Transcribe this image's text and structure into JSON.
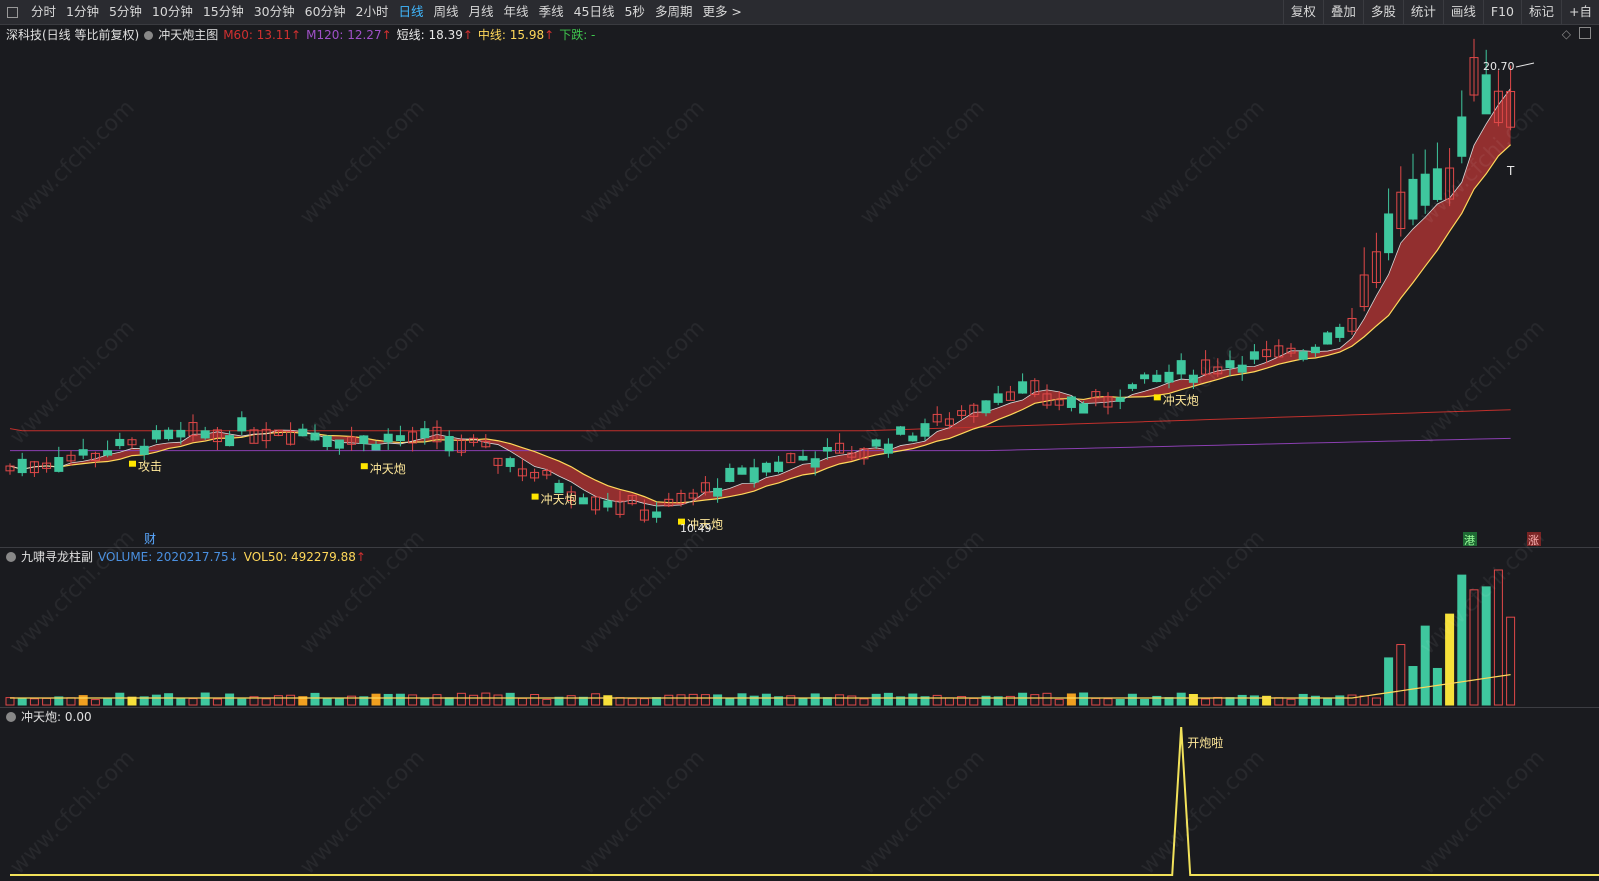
{
  "toolbar": {
    "tabs": [
      "分时",
      "1分钟",
      "5分钟",
      "10分钟",
      "15分钟",
      "30分钟",
      "60分钟",
      "2小时",
      "日线",
      "周线",
      "月线",
      "年线",
      "季线",
      "45日线",
      "5秒",
      "多周期",
      "更多 >"
    ],
    "active_tab": "日线",
    "right_buttons": [
      "复权",
      "叠加",
      "多股",
      "统计",
      "画线",
      "F10",
      "标记",
      "+自"
    ]
  },
  "main_legend": {
    "stock": "深科技(日线 等比前复权)",
    "indicator": "冲天炮主图",
    "m60": "M60: 13.11",
    "m120": "M120: 12.27",
    "short_line": "短线: 18.39",
    "mid_line": "中线: 15.98",
    "fall": "下跌: -"
  },
  "main_annotations": {
    "high_price": "20.70",
    "low_price": "10.49",
    "attack": "攻击",
    "cannon": "冲天炮",
    "cai": "财",
    "gang": "港",
    "zhang": "涨",
    "t_mark": "T"
  },
  "volume_legend": {
    "name": "九啸寻龙柱副",
    "volume": "VOLUME: 2020217.75",
    "vol50": "VOL50: 492279.88"
  },
  "signal_legend": {
    "name": "冲天炮",
    "value": ": 0.00",
    "peak_label": "开炮啦"
  },
  "watermark": "www.cfchi.com",
  "colors": {
    "up": "#e04848",
    "down": "#3fc79e",
    "ribbon": "#a83232",
    "short": "#ffd85a",
    "m60": "#c0302c",
    "m120": "#8a3fb0",
    "signal": "#f2e25a"
  }
}
